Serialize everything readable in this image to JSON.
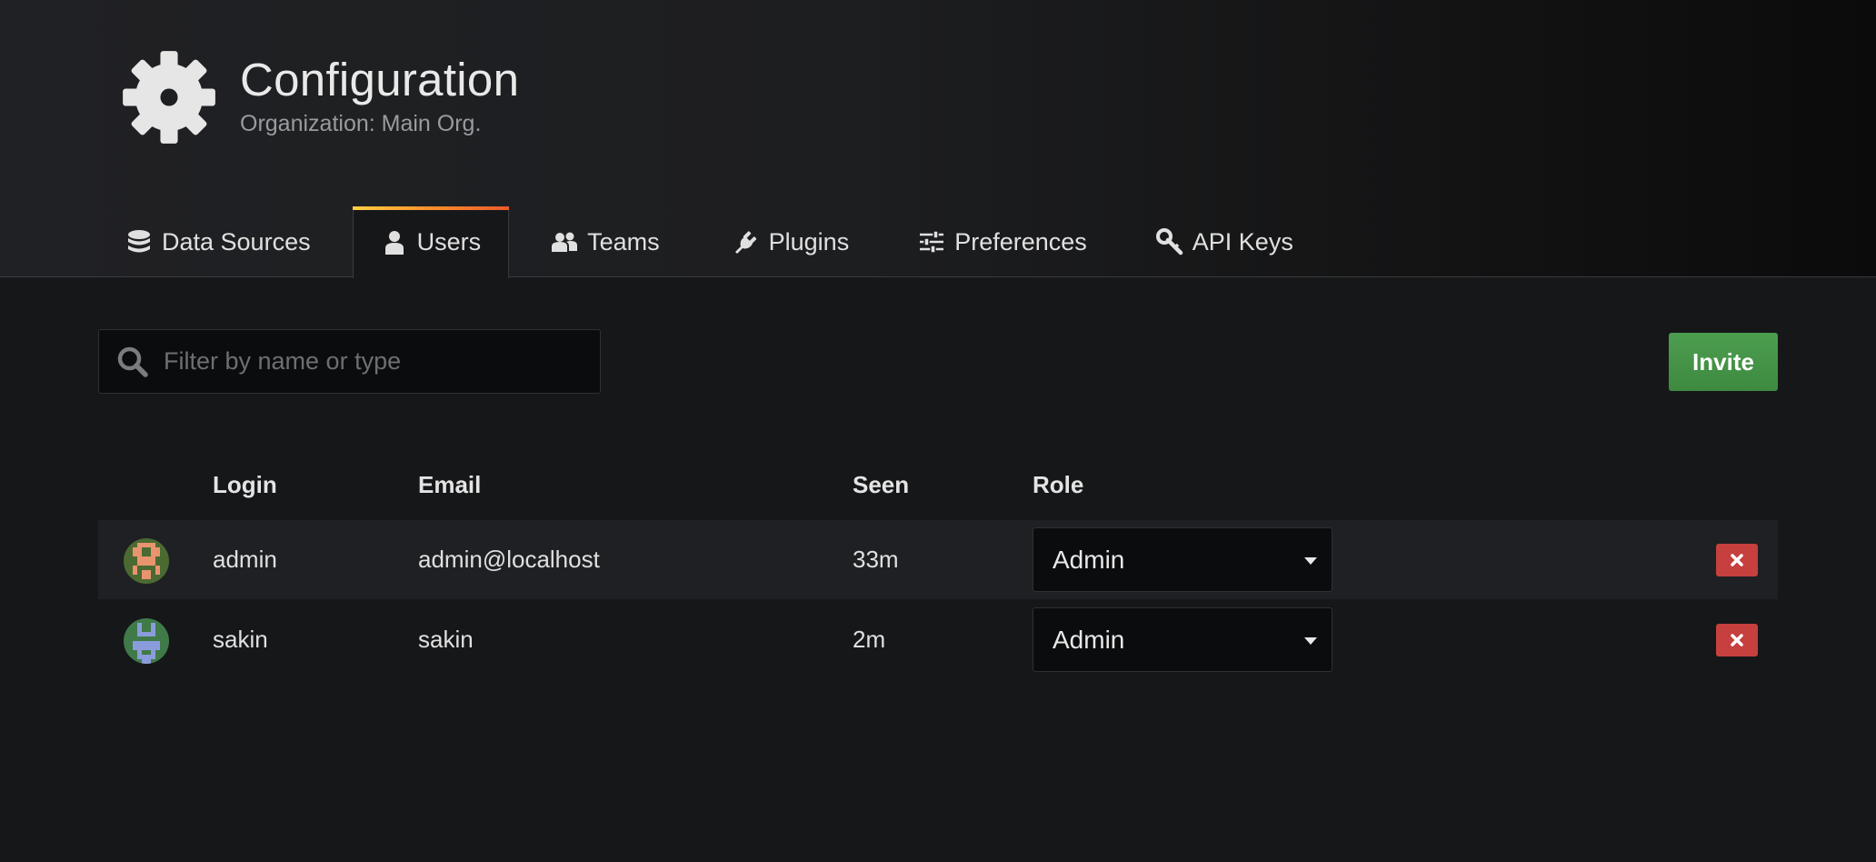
{
  "header": {
    "title": "Configuration",
    "subtitle": "Organization: Main Org."
  },
  "tabs": [
    {
      "label": "Data Sources",
      "icon": "database-icon"
    },
    {
      "label": "Users",
      "icon": "user-icon",
      "active": true
    },
    {
      "label": "Teams",
      "icon": "users-icon"
    },
    {
      "label": "Plugins",
      "icon": "plug-icon"
    },
    {
      "label": "Preferences",
      "icon": "sliders-icon"
    },
    {
      "label": "API Keys",
      "icon": "key-icon"
    }
  ],
  "filter": {
    "placeholder": "Filter by name or type",
    "value": ""
  },
  "invite_label": "Invite",
  "table": {
    "headers": {
      "login": "Login",
      "email": "Email",
      "seen": "Seen",
      "role": "Role"
    },
    "rows": [
      {
        "login": "admin",
        "email": "admin@localhost",
        "seen": "33m",
        "role": "Admin"
      },
      {
        "login": "sakin",
        "email": "sakin",
        "seen": "2m",
        "role": "Admin"
      }
    ]
  },
  "colors": {
    "accent_gradient": [
      "#ffd044",
      "#ea5a2c"
    ],
    "invite_button": "#3d8a40",
    "delete_button": "#c5403e",
    "background": "#161719"
  }
}
